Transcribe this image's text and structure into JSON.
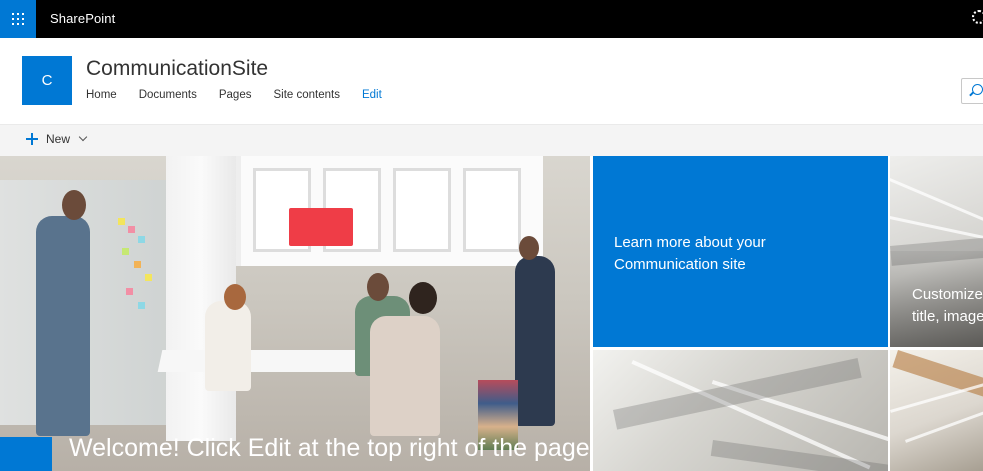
{
  "suitebar": {
    "brand": "SharePoint"
  },
  "header": {
    "logo_letter": "C",
    "site_title": "CommunicationSite",
    "nav_items": [
      "Home",
      "Documents",
      "Pages",
      "Site contents"
    ],
    "edit_label": "Edit"
  },
  "commandbar": {
    "new_label": "New"
  },
  "hero": {
    "main_caption": "Welcome! Click Edit at the top right of the page",
    "blue_tile_text": "Learn more about your Communication site",
    "right_tile_text_line1": "Customize",
    "right_tile_text_line2": "title, image"
  },
  "icons": [
    "app-launcher-icon",
    "settings-icon",
    "search-icon",
    "plus-icon",
    "chevron-down-icon"
  ],
  "colors": {
    "accent": "#0078d4",
    "suitebar": "#000000",
    "commandbar": "#f4f4f4",
    "text": "#333333"
  }
}
